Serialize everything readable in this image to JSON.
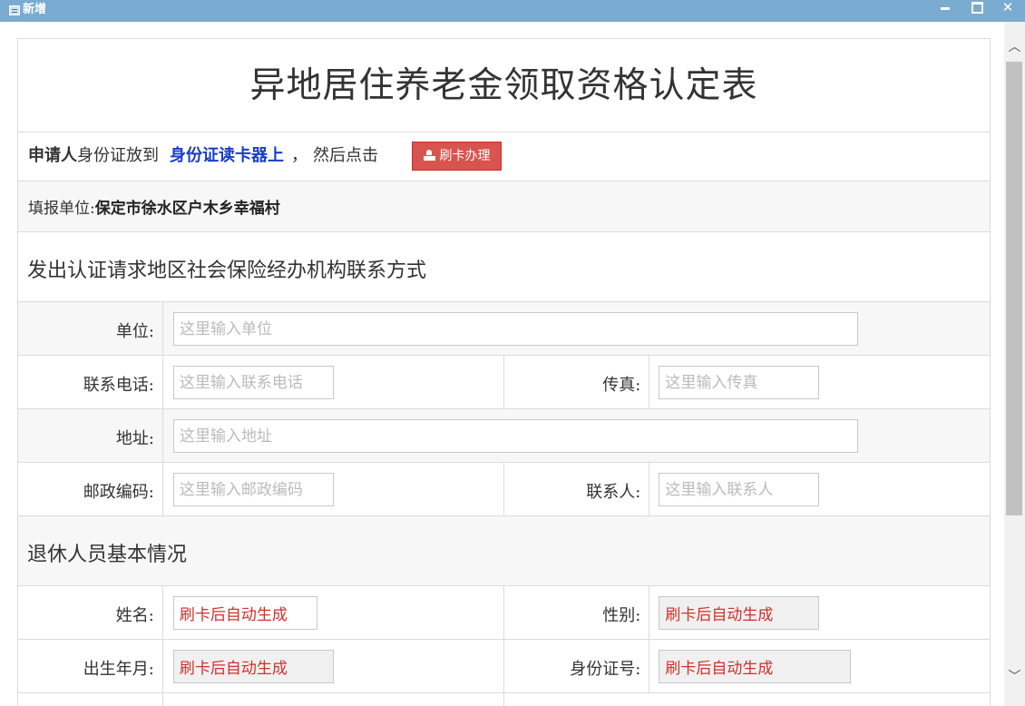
{
  "window": {
    "title": "新增",
    "close_glyph": "✕"
  },
  "scrollbar": {
    "up_glyph": "︿",
    "down_glyph": "﹀"
  },
  "form": {
    "title": "异地居住养老金领取资格认定表",
    "instruction": {
      "prefix_bold": "申请人",
      "text1": "身份证放到",
      "highlight": "身份证读卡器上",
      "comma": "，",
      "text2": "然后点击",
      "button_label": "刷卡办理"
    },
    "unit_label": "填报单位:",
    "unit_value": "保定市徐水区户木乡幸福村",
    "contact_section": {
      "title": "发出认证请求地区社会保险经办机构联系方式",
      "unit": {
        "label": "单位:",
        "placeholder": "这里输入单位",
        "value": ""
      },
      "phone": {
        "label": "联系电话:",
        "placeholder": "这里输入联系电话",
        "value": ""
      },
      "fax": {
        "label": "传真:",
        "placeholder": "这里输入传真",
        "value": ""
      },
      "address": {
        "label": "地址:",
        "placeholder": "这里输入地址",
        "value": ""
      },
      "postcode": {
        "label": "邮政编码:",
        "placeholder": "这里输入邮政编码",
        "value": ""
      },
      "contact_person": {
        "label": "联系人:",
        "placeholder": "这里输入联系人",
        "value": ""
      }
    },
    "retiree_section": {
      "title": "退休人员基本情况",
      "name": {
        "label": "姓名:",
        "value": "刷卡后自动生成"
      },
      "gender": {
        "label": "性别:",
        "value": "刷卡后自动生成"
      },
      "birth": {
        "label": "出生年月:",
        "value": "刷卡后自动生成"
      },
      "id_number": {
        "label": "身份证号:",
        "value": "刷卡后自动生成"
      }
    }
  },
  "colors": {
    "titlebar": "#7aabd0",
    "button": "#d9534f",
    "highlight": "#1a3cc8",
    "autogen_text": "#d0312d"
  }
}
